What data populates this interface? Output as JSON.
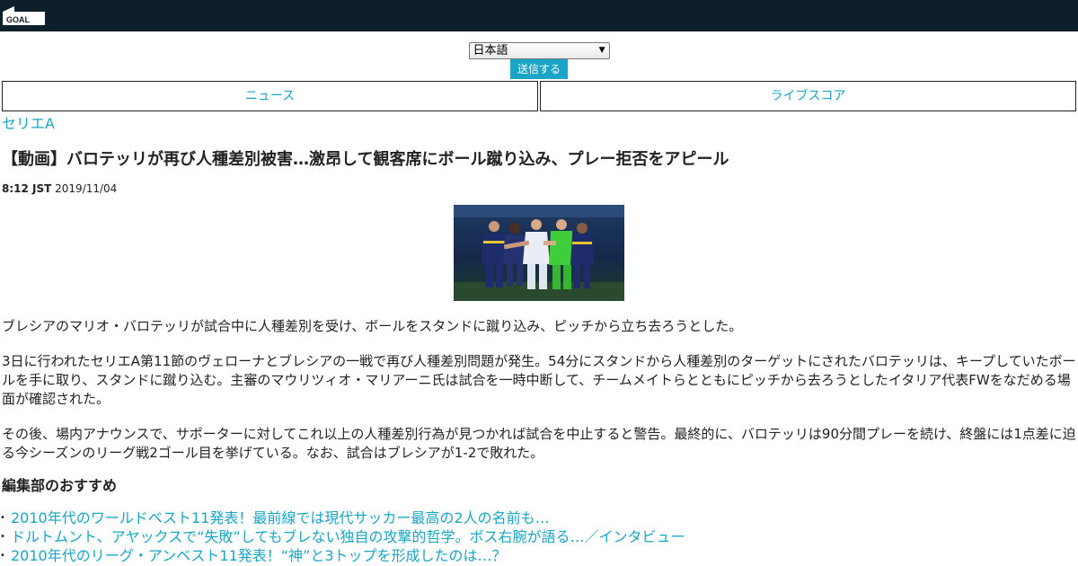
{
  "header": {
    "logo_text": "GOAL",
    "brand_color": "#0c1f2b",
    "accent_color": "#1aa5c6"
  },
  "language": {
    "selected": "日本語",
    "submit_label": "送信する"
  },
  "nav": {
    "items": [
      {
        "label": "ニュース"
      },
      {
        "label": "ライブスコア"
      }
    ]
  },
  "article": {
    "category": "セリエA",
    "title": "【動画】バロテッリが再び人種差別被害…激昂して観客席にボール蹴り込み、プレー拒否をアピール",
    "time": "8:12 JST",
    "date": "2019/11/04",
    "paragraphs": [
      "ブレシアのマリオ・バロテッリが試合中に人種差別を受け、ボールをスタンドに蹴り込み、ピッチから立ち去ろうとした。",
      "3日に行われたセリエA第11節のヴェローナとブレシアの一戦で再び人種差別問題が発生。54分にスタンドから人種差別のターゲットにされたバロテッリは、キープしていたボールを手に取り、スタンドに蹴り込む。主審のマウリツィオ・マリアーニ氏は試合を一時中断して、チームメイトらとともにピッチから去ろうとしたイタリア代表FWをなだめる場面が確認された。",
      "その後、場内アナウンスで、サポーターに対してこれ以上の人種差別行為が見つかれば試合を中止すると警告。最終的に、バロテッリは90分間プレーを続け、終盤には1点差に迫る今シーズンのリーグ戦2ゴール目を挙げている。なお、試合はブレシアが1-2で敗れた。"
    ]
  },
  "recommendations": {
    "title": "編集部のおすすめ",
    "items": [
      "2010年代のワールドベスト11発表！最前線では現代サッカー最高の2人の名前も…",
      "ドルトムント、アヤックスで“失敗”してもブレない独自の攻撃的哲学。ボス右腕が語る…／インタビュー",
      "2010年代のリーグ・アンベスト11発表！“神”と3トップを形成したのは…？"
    ]
  }
}
